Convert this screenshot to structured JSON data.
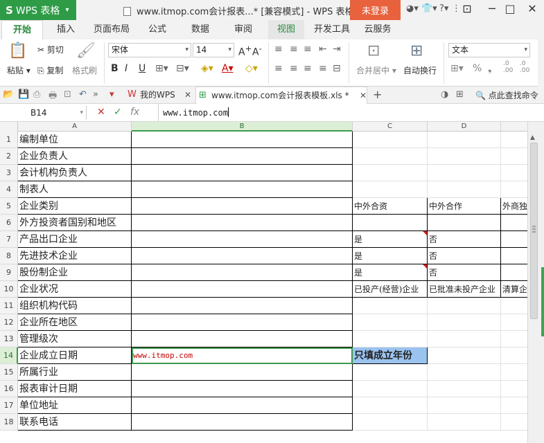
{
  "app": {
    "name": "WPS 表格",
    "doc_title": "www.itmop.com会计报表...* [兼容模式] - WPS 表格",
    "login": "未登录"
  },
  "menu": {
    "tabs": [
      {
        "label": "开始"
      },
      {
        "label": "插入"
      },
      {
        "label": "页面布局"
      },
      {
        "label": "公式"
      },
      {
        "label": "数据"
      },
      {
        "label": "审阅"
      },
      {
        "label": "视图"
      },
      {
        "label": "开发工具"
      },
      {
        "label": "云服务"
      }
    ]
  },
  "ribbon": {
    "paste": "粘贴",
    "cut": "剪切",
    "copy": "复制",
    "format_painter": "格式刷",
    "font_name": "宋体",
    "font_size": "14",
    "merge_center": "合并居中",
    "wrap": "自动换行",
    "number_format": "文本",
    "percent": "%",
    "comma": "❟",
    "inc_dec": ".0\n.00"
  },
  "doc_tabs": {
    "my_wps": "我的WPS",
    "file": "www.itmop.com会计报表模板.xls *",
    "find_cmd": "点此查找命令"
  },
  "formula_bar": {
    "name_box": "B14",
    "fx": "fx",
    "content": "www.itmop.com"
  },
  "columns": [
    "A",
    "B",
    "C",
    "D"
  ],
  "rows": [
    {
      "n": "1",
      "a": "编制单位",
      "b": "",
      "c": "",
      "d": "",
      "e": ""
    },
    {
      "n": "2",
      "a": "企业负责人",
      "b": "",
      "c": "",
      "d": "",
      "e": ""
    },
    {
      "n": "3",
      "a": "会计机构负责人",
      "b": "",
      "c": "",
      "d": "",
      "e": ""
    },
    {
      "n": "4",
      "a": "制表人",
      "b": "",
      "c": "",
      "d": "",
      "e": ""
    },
    {
      "n": "5",
      "a": "企业类别",
      "b": "",
      "c": "中外合资",
      "d": "中外合作",
      "e": "外商独"
    },
    {
      "n": "6",
      "a": "外方投资者国别和地区",
      "b": "",
      "c": "",
      "d": "",
      "e": ""
    },
    {
      "n": "7",
      "a": "产品出口企业",
      "b": "",
      "c": "是",
      "d": "否",
      "e": ""
    },
    {
      "n": "8",
      "a": "先进技术企业",
      "b": "",
      "c": "是",
      "d": "否",
      "e": ""
    },
    {
      "n": "9",
      "a": "股份制企业",
      "b": "",
      "c": "是",
      "d": "否",
      "e": ""
    },
    {
      "n": "10",
      "a": "企业状况",
      "b": "",
      "c": "已投产(经营)企业",
      "d": "已批准未投产企业",
      "e": "清算企"
    },
    {
      "n": "11",
      "a": "组织机构代码",
      "b": "",
      "c": "",
      "d": "",
      "e": ""
    },
    {
      "n": "12",
      "a": "企业所在地区",
      "b": "",
      "c": "",
      "d": "",
      "e": ""
    },
    {
      "n": "13",
      "a": "管理级次",
      "b": "",
      "c": "",
      "d": "",
      "e": ""
    },
    {
      "n": "14",
      "a": "企业成立日期",
      "b": "www.itmop.com",
      "c": "只填成立年份",
      "d": "",
      "e": ""
    },
    {
      "n": "15",
      "a": "所属行业",
      "b": "",
      "c": "",
      "d": "",
      "e": ""
    },
    {
      "n": "16",
      "a": "报表审计日期",
      "b": "",
      "c": "",
      "d": "",
      "e": ""
    },
    {
      "n": "17",
      "a": "单位地址",
      "b": "",
      "c": "",
      "d": "",
      "e": ""
    },
    {
      "n": "18",
      "a": "联系电话",
      "b": "",
      "c": "",
      "d": "",
      "e": ""
    }
  ],
  "colors": {
    "app_green": "#2e9b47",
    "login_orange": "#e8623d",
    "selection_green": "#3b9a4c",
    "highlight_blue": "#9bc3f0",
    "text_red": "#c00000"
  }
}
